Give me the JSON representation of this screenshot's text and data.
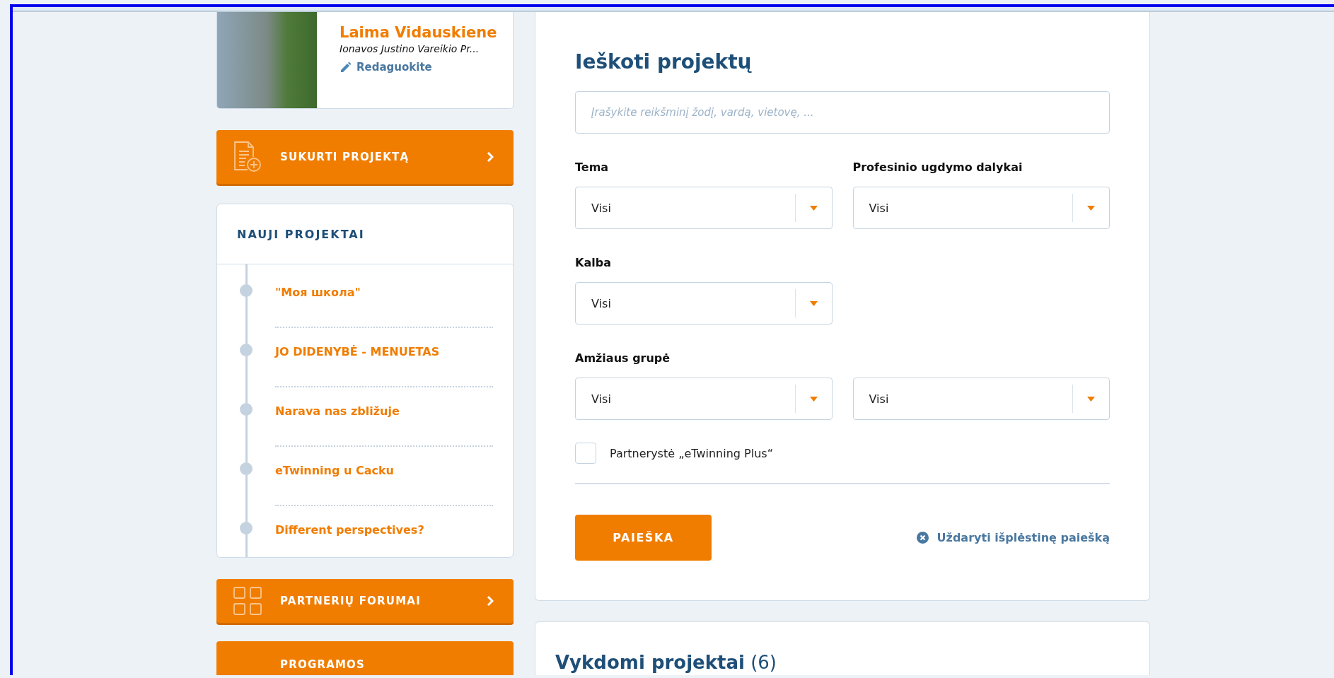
{
  "profile": {
    "name": "Laima Vidauskiene",
    "school": "Ionavos Justino Vareikio Pr...",
    "edit_link": "Redaguokite"
  },
  "sidebar_buttons_top": [
    {
      "label": "SUKURTI PROJEKTĄ",
      "kind": "create"
    }
  ],
  "new_projects": {
    "title": "NAUJI PROJEKTAI",
    "items": [
      {
        "title": "\"Моя школа\""
      },
      {
        "title": "JO DIDENYBĖ - MENUETAS"
      },
      {
        "title": "Narava nas zbližuje"
      },
      {
        "title": "eTwinning u Cacku"
      },
      {
        "title": "Different perspectives?"
      }
    ]
  },
  "sidebar_buttons_bottom": [
    {
      "label": "PARTNERIŲ FORUMAI",
      "kind": "forums"
    },
    {
      "label": "PROGRAMOS",
      "kind": "programs"
    }
  ],
  "search": {
    "title": "Ieškoti projektų",
    "placeholder": "Įrašykite reikšminį žodį, vardą, vietovę, ...",
    "filter_rows": [
      {
        "fields": [
          {
            "label": "Tema",
            "selects": [
              "Visi"
            ]
          },
          {
            "label": "Profesinio ugdymo dalykai",
            "selects": [
              "Visi"
            ]
          }
        ]
      },
      {
        "fields": [
          {
            "label": "Kalba",
            "selects": [
              "Visi"
            ]
          }
        ]
      },
      {
        "fields": [
          {
            "label": "Amžiaus grupė",
            "selects": [
              "Visi",
              "Visi"
            ]
          }
        ]
      }
    ],
    "checkbox": {
      "label": "Partnerystė „eTwinning Plus“",
      "checked": false
    },
    "search_button": "PAIEŠKA",
    "close_link": "Uždaryti išplėstinę paiešką"
  },
  "running_projects": {
    "title": "Vykdomi projektai",
    "count": "(6)"
  }
}
